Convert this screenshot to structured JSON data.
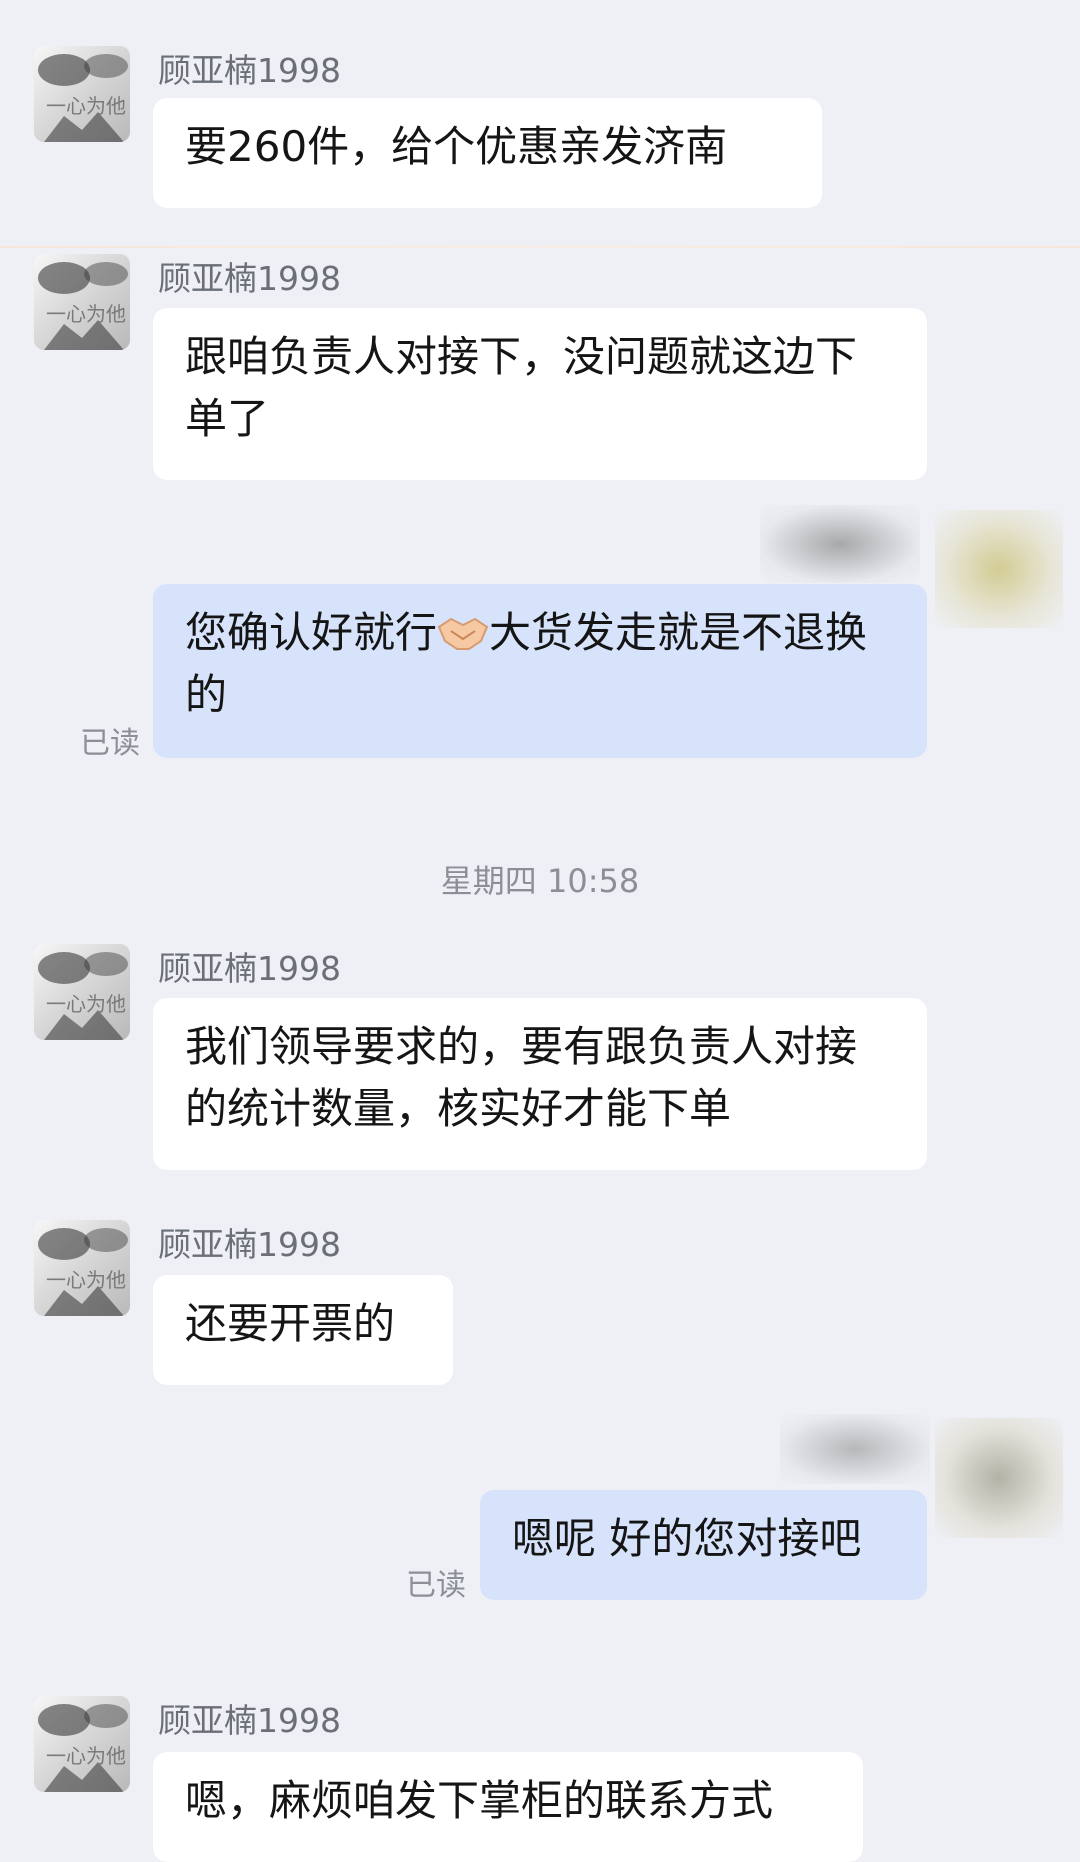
{
  "messages": [
    {
      "sender": "顾亚楠1998",
      "avatar_label": "一心为他",
      "text": "要260件，给个优惠亲发济南"
    },
    {
      "sender": "顾亚楠1998",
      "avatar_label": "一心为他",
      "text": "跟咱负责人对接下，没问题就这边下单了"
    },
    {
      "me_text_before": "您确认好就行",
      "me_emoji": "handshake-emoji",
      "me_text_after": "大货发走就是不退换的",
      "read": "已读"
    },
    {
      "sender": "顾亚楠1998",
      "avatar_label": "一心为他",
      "text": "我们领导要求的，要有跟负责人对接的统计数量，核实好才能下单"
    },
    {
      "sender": "顾亚楠1998",
      "avatar_label": "一心为他",
      "text": "还要开票的"
    },
    {
      "me_text": "嗯呢 好的您对接吧",
      "read": "已读"
    },
    {
      "sender": "顾亚楠1998",
      "avatar_label": "一心为他",
      "text": "嗯，麻烦咱发下掌柜的联系方式"
    }
  ],
  "timestamp": "星期四 10:58",
  "colors": {
    "background": "#eef0f5",
    "incoming_bubble": "#ffffff",
    "outgoing_bubble": "#d7e3fb",
    "meta_text": "#8b8f96"
  }
}
